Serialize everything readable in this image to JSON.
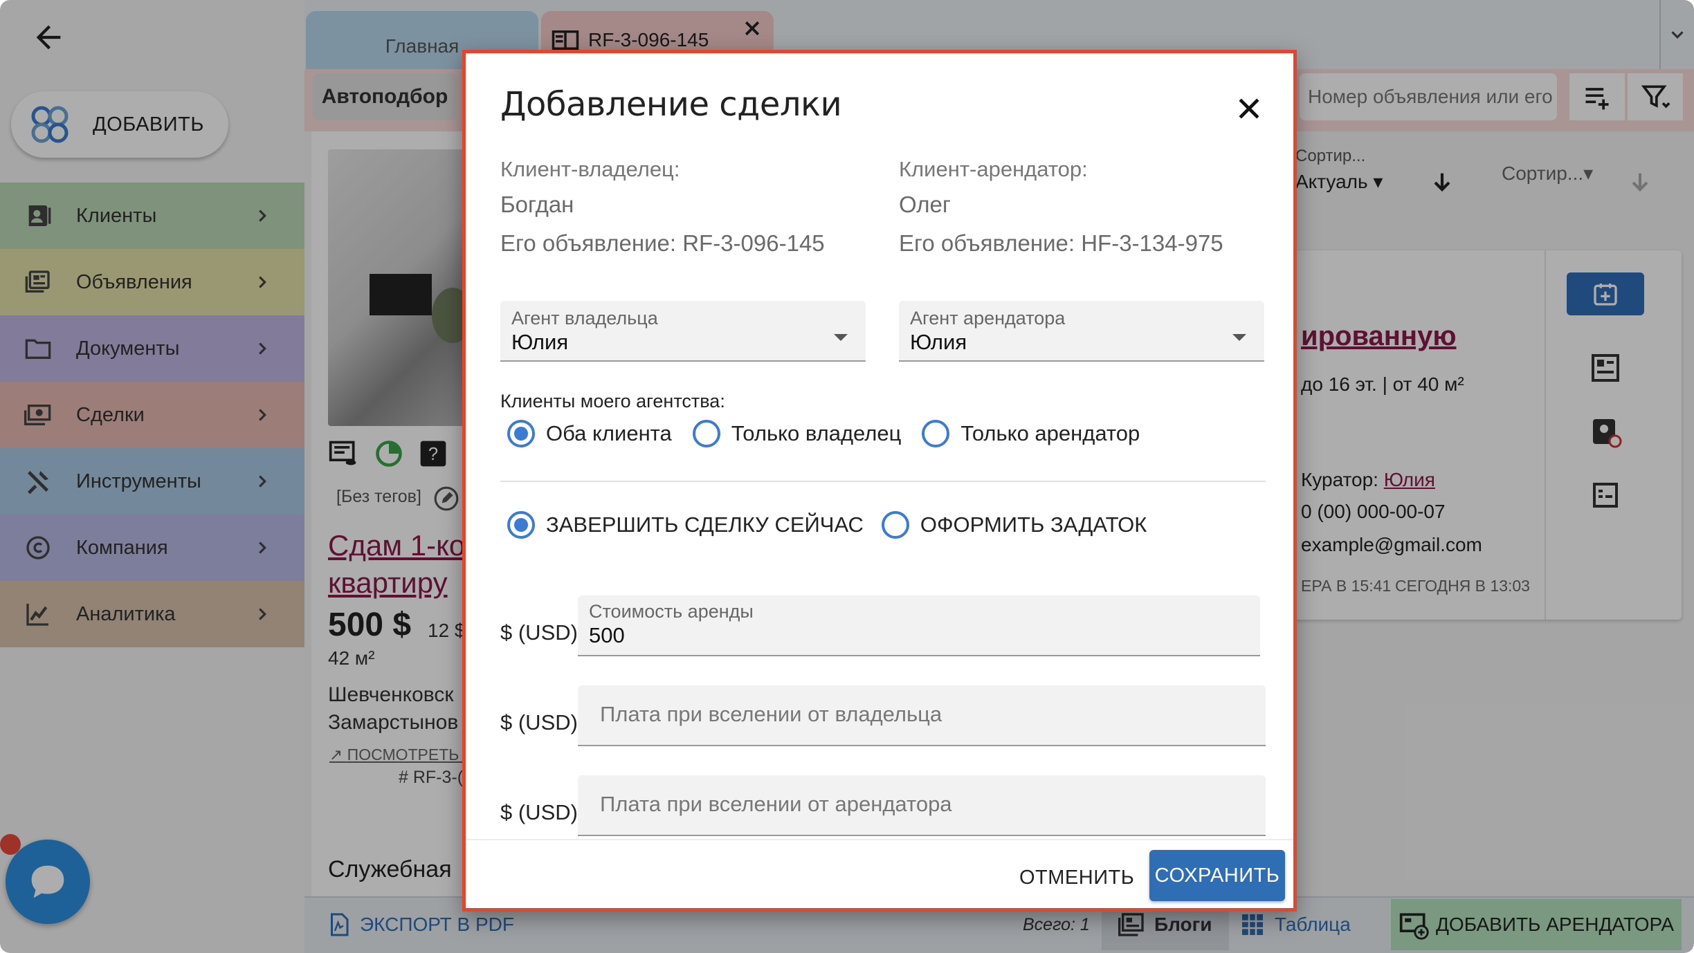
{
  "sidebar": {
    "add_label": "ДОБАВИТЬ",
    "items": [
      {
        "label": "Клиенты",
        "color": "#bcd8b5"
      },
      {
        "label": "Объявления",
        "color": "#e3e0a9"
      },
      {
        "label": "Документы",
        "color": "#c2b5e3"
      },
      {
        "label": "Сделки",
        "color": "#e8b8b2"
      },
      {
        "label": "Инструменты",
        "color": "#aac9e4"
      },
      {
        "label": "Компания",
        "color": "#b9b9e6"
      },
      {
        "label": "Аналитика",
        "color": "#d8c1ad"
      }
    ]
  },
  "tabs": {
    "home": "Главная",
    "listing": "RF-3-096-145"
  },
  "toolbar": {
    "autopick": "Автоподбор",
    "search_placeholder": "Номер объявления или его"
  },
  "listing_card": {
    "tags": "[Без тегов]",
    "title_line1": "Сдам 1-ко",
    "title_line2": "квартиру",
    "price": "500 $",
    "price_extra": "12 $",
    "area": "42 м²",
    "address_line1": "Шевченковск",
    "address_line2": "Замарстынов",
    "view_link": "ПОСМОТРЕТЬ Н",
    "id_text": "# RF-3-(",
    "section": "Служебная"
  },
  "sort": {
    "label1_small": "Сортир...",
    "label1_value": "Актуаль",
    "label2": "Сортир..."
  },
  "right_card": {
    "title_fragment": "ированную",
    "floors": "до 16 эт. | от 40 м²",
    "curator_label": "Куратор:",
    "curator_name": "Юлия",
    "phone": "0 (00) 000-00-07",
    "email": "example@gmail.com",
    "date1": "ЕРА В 15:41",
    "date2": "СЕГОДНЯ В 13:03"
  },
  "bottom_bar": {
    "export": "ЭКСПОРТ В PDF",
    "total": "Всего: 1",
    "blocks": "Блоги",
    "table": "Таблица",
    "add_tenant": "ДОБАВИТЬ АРЕНДАТОРА"
  },
  "modal": {
    "title": "Добавление сделки",
    "owner_client_label": "Клиент-владелец:",
    "owner_client_name": "Богдан",
    "owner_listing": "Его объявление: RF-3-096-145",
    "tenant_client_label": "Клиент-арендатор:",
    "tenant_client_name": "Олег",
    "tenant_listing": "Его объявление: HF-3-134-975",
    "owner_agent_label": "Агент владельца",
    "owner_agent_value": "Юлия",
    "tenant_agent_label": "Агент арендатора",
    "tenant_agent_value": "Юлия",
    "clients_group_label": "Клиенты моего агентства:",
    "clients_options": [
      "Оба клиента",
      "Только владелец",
      "Только арендатор"
    ],
    "clients_selected": 0,
    "deal_options": [
      "ЗАВЕРШИТЬ СДЕЛКУ СЕЙЧАС",
      "ОФОРМИТЬ ЗАДАТОК"
    ],
    "deal_selected": 0,
    "currency": "$ (USD)",
    "rent_label": "Стоимость аренды",
    "rent_value": "500",
    "owner_fee_placeholder": "Плата при вселении от владельца",
    "tenant_fee_placeholder": "Плата при вселении от арендатора",
    "cancel": "ОТМЕНИТЬ",
    "save": "СОХРАНИТЬ"
  }
}
